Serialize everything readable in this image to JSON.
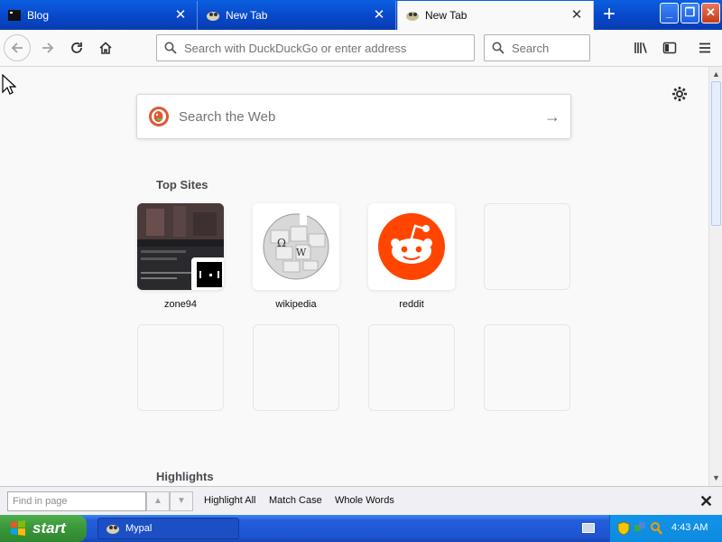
{
  "tabs": [
    {
      "title": "Blog",
      "selected": false
    },
    {
      "title": "New Tab",
      "selected": false
    },
    {
      "title": "New Tab",
      "selected": true
    }
  ],
  "toolbar": {
    "address_placeholder": "Search with DuckDuckGo or enter address",
    "search_placeholder": "Search"
  },
  "newtab": {
    "web_search_placeholder": "Search the Web",
    "top_sites_title": "Top Sites",
    "highlights_title": "Highlights",
    "top_sites": [
      {
        "label": "zone94"
      },
      {
        "label": "wikipedia"
      },
      {
        "label": "reddit"
      }
    ]
  },
  "findbar": {
    "placeholder": "Find in page",
    "highlight_all": "Highlight All",
    "match_case": "Match Case",
    "whole_words": "Whole Words"
  },
  "taskbar": {
    "start_label": "start",
    "task_label": "Mypal",
    "clock": "4:43 AM"
  },
  "colors": {
    "xp_blue": "#0846c8",
    "reddit_orange": "#ff4500",
    "ddg_orange": "#de5833",
    "start_green": "#3c9a3c"
  }
}
